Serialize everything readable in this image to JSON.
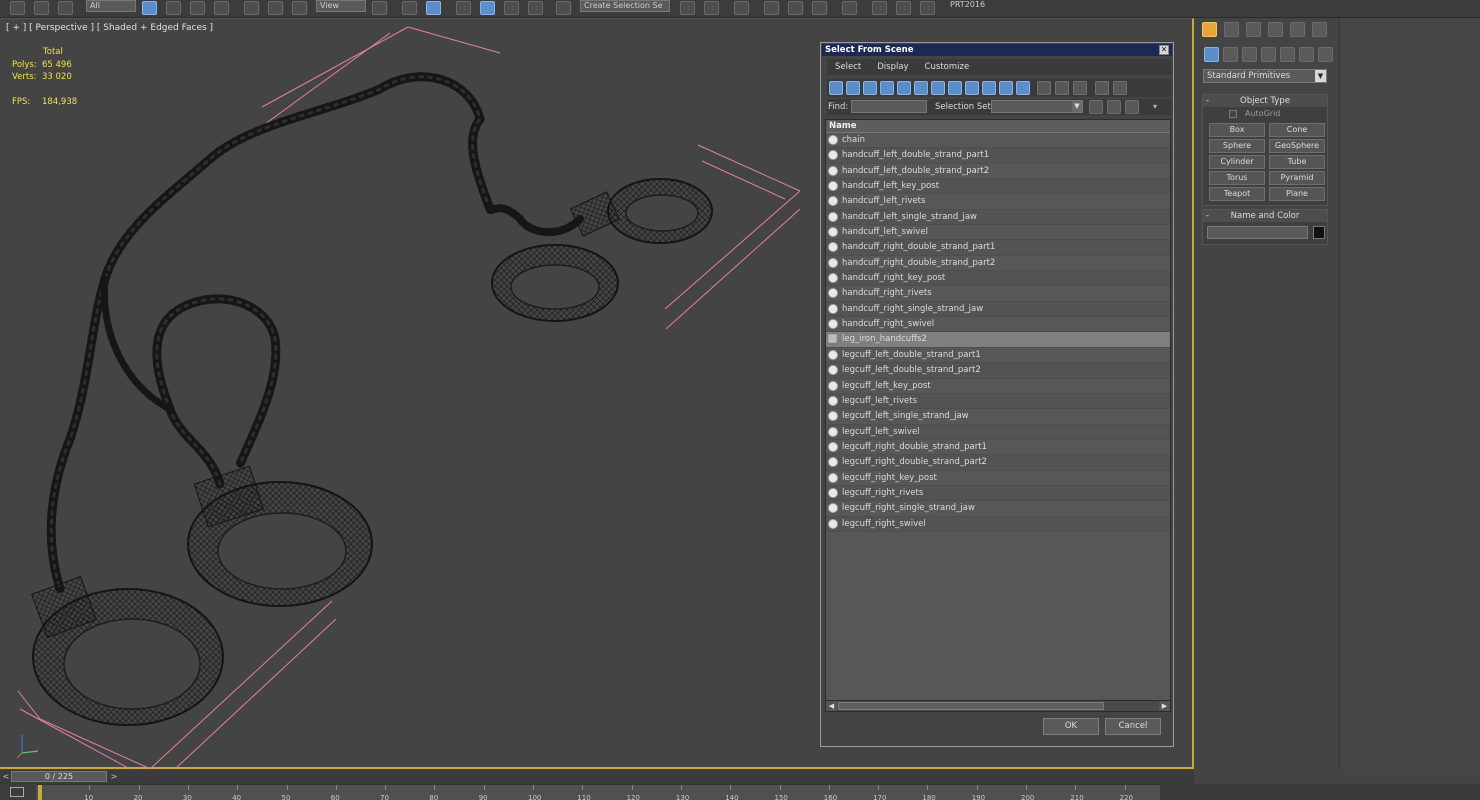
{
  "toolbar": {
    "dropdown_all": "All",
    "dropdown_view": "View",
    "dropdown_selset": "Create Selection Se",
    "version_label": "PRT2016"
  },
  "viewport": {
    "label": "[ + ] [ Perspective ] [ Shaded + Edged Faces ]",
    "stats": {
      "total_label": "Total",
      "polys_label": "Polys:",
      "polys_value": "65 496",
      "verts_label": "Verts:",
      "verts_value": "33 020",
      "fps_label": "FPS:",
      "fps_value": "184,938"
    },
    "axis": {
      "x": "x",
      "y": "y",
      "z": "z"
    }
  },
  "dialog": {
    "title": "Select From Scene",
    "close_glyph": "✕",
    "menu": [
      "Select",
      "Display",
      "Customize"
    ],
    "find_label": "Find:",
    "find_value": "",
    "selection_set_label": "Selection Set:",
    "selection_set_value": "",
    "column_header": "Name",
    "items": [
      {
        "name": "chain",
        "type": "object"
      },
      {
        "name": "handcuff_left_double_strand_part1",
        "type": "object"
      },
      {
        "name": "handcuff_left_double_strand_part2",
        "type": "object"
      },
      {
        "name": "handcuff_left_key_post",
        "type": "object"
      },
      {
        "name": "handcuff_left_rivets",
        "type": "object"
      },
      {
        "name": "handcuff_left_single_strand_jaw",
        "type": "object"
      },
      {
        "name": "handcuff_left_swivel",
        "type": "object"
      },
      {
        "name": "handcuff_right_double_strand_part1",
        "type": "object"
      },
      {
        "name": "handcuff_right_double_strand_part2",
        "type": "object"
      },
      {
        "name": "handcuff_right_key_post",
        "type": "object"
      },
      {
        "name": "handcuff_right_rivets",
        "type": "object"
      },
      {
        "name": "handcuff_right_single_strand_jaw",
        "type": "object"
      },
      {
        "name": "handcuff_right_swivel",
        "type": "object"
      },
      {
        "name": "leg_iron_handcuffs2",
        "type": "group"
      },
      {
        "name": "legcuff_left_double_strand_part1",
        "type": "object"
      },
      {
        "name": "legcuff_left_double_strand_part2",
        "type": "object"
      },
      {
        "name": "legcuff_left_key_post",
        "type": "object"
      },
      {
        "name": "legcuff_left_rivets",
        "type": "object"
      },
      {
        "name": "legcuff_left_single_strand_jaw",
        "type": "object"
      },
      {
        "name": "legcuff_left_swivel",
        "type": "object"
      },
      {
        "name": "legcuff_right_double_strand_part1",
        "type": "object"
      },
      {
        "name": "legcuff_right_double_strand_part2",
        "type": "object"
      },
      {
        "name": "legcuff_right_key_post",
        "type": "object"
      },
      {
        "name": "legcuff_right_rivets",
        "type": "object"
      },
      {
        "name": "legcuff_right_single_strand_jaw",
        "type": "object"
      },
      {
        "name": "legcuff_right_swivel",
        "type": "object"
      }
    ],
    "selected_index": 13,
    "ok_label": "OK",
    "cancel_label": "Cancel"
  },
  "command_panel": {
    "category_dropdown": "Standard Primitives",
    "object_type_title": "Object Type",
    "autogrid_label": "AutoGrid",
    "primitives": [
      "Box",
      "Cone",
      "Sphere",
      "GeoSphere",
      "Cylinder",
      "Tube",
      "Torus",
      "Pyramid",
      "Teapot",
      "Plane"
    ],
    "name_color_title": "Name and Color",
    "name_value": "",
    "swatch_color": "#111111",
    "collapse_glyph": "-"
  },
  "timeline": {
    "frame_display": "0 / 225",
    "prev_glyph": "<",
    "next_glyph": ">",
    "ticks": [
      10,
      20,
      30,
      40,
      50,
      60,
      70,
      80,
      90,
      100,
      110,
      120,
      130,
      140,
      150,
      160,
      170,
      180,
      190,
      200,
      210,
      220
    ]
  },
  "colors": {
    "accent_blue": "#5b8dc9",
    "viewport_border": "#c9a93d",
    "stats_text": "#f2e14a",
    "bbox_pink": "#e07fa8",
    "title_bar": "#1b2a55"
  }
}
